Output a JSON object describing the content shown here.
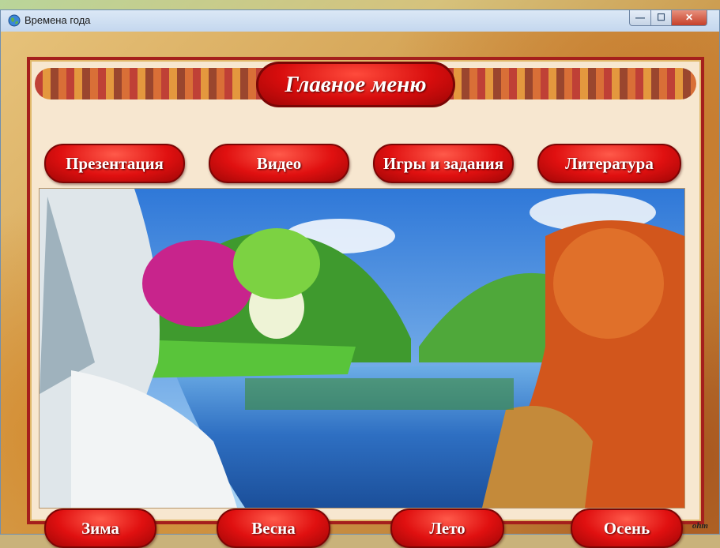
{
  "window": {
    "title": "Времена года",
    "min_glyph": "—",
    "max_glyph": "☐",
    "close_glyph": "✕"
  },
  "menu": {
    "title": "Главное меню",
    "top_buttons": [
      "Презентация",
      "Видео",
      "Игры и задания",
      "Литература"
    ],
    "season_buttons": [
      "Зима",
      "Весна",
      "Лето",
      "Осень"
    ]
  },
  "watermark": "ohm",
  "colors": {
    "button_red": "#e01010",
    "frame_red": "#a51f1c",
    "frame_fill": "#f7e7d0"
  }
}
